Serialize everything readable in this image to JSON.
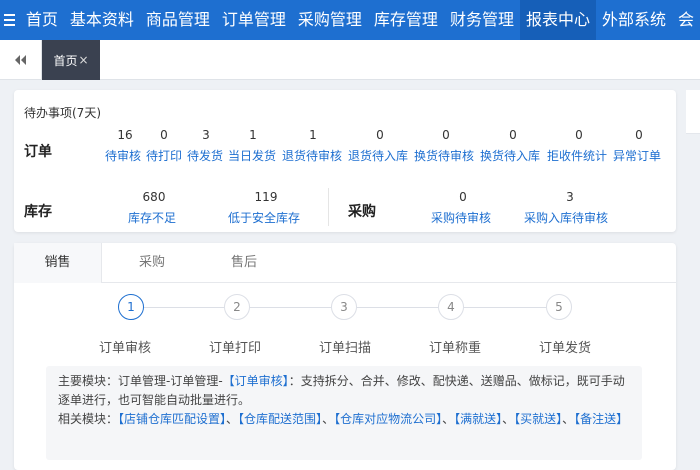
{
  "nav": {
    "items": [
      "首页",
      "基本资料",
      "商品管理",
      "订单管理",
      "采购管理",
      "库存管理",
      "财务管理",
      "报表中心",
      "外部系统",
      "会"
    ],
    "active_index": 7
  },
  "tabs": {
    "home_label": "首页",
    "close_glyph": "×"
  },
  "todo": {
    "title": "待办事项(7天)",
    "order": {
      "label": "订单",
      "items": [
        {
          "count": "16",
          "label": "待审核"
        },
        {
          "count": "0",
          "label": "待打印"
        },
        {
          "count": "3",
          "label": "待发货"
        },
        {
          "count": "1",
          "label": "当日发货"
        },
        {
          "count": "1",
          "label": "退货待审核"
        },
        {
          "count": "0",
          "label": "退货待入库"
        },
        {
          "count": "0",
          "label": "换货待审核"
        },
        {
          "count": "0",
          "label": "换货待入库"
        },
        {
          "count": "0",
          "label": "拒收件统计"
        },
        {
          "count": "0",
          "label": "异常订单"
        }
      ]
    },
    "stock": {
      "label": "库存",
      "items": [
        {
          "count": "680",
          "label": "库存不足"
        },
        {
          "count": "119",
          "label": "低于安全库存"
        }
      ]
    },
    "purchase": {
      "label": "采购",
      "items": [
        {
          "count": "0",
          "label": "采购待审核"
        },
        {
          "count": "3",
          "label": "采购入库待审核"
        }
      ]
    }
  },
  "flow": {
    "tabs": [
      "销售",
      "采购",
      "售后"
    ],
    "active_tab": 0,
    "steps": [
      {
        "num": "1",
        "label": "订单审核"
      },
      {
        "num": "2",
        "label": "订单打印"
      },
      {
        "num": "3",
        "label": "订单扫描"
      },
      {
        "num": "4",
        "label": "订单称重"
      },
      {
        "num": "5",
        "label": "订单发货"
      }
    ],
    "active_step": 0,
    "info": {
      "main_prefix": "主要模块：订单管理-订单管理-",
      "main_link": "【订单审核】",
      "main_desc": "：支持拆分、合并、修改、配快递、送赠品、做标记，既可手动逐单进行，也可智能自动批量进行。",
      "related_prefix": "相关模块：",
      "related_links": [
        "【店铺仓库匹配设置】",
        "【仓库配送范围】",
        "【仓库对应物流公司】",
        "【满就送】",
        "【买就送】",
        "【备注送】"
      ],
      "separator": "、"
    }
  },
  "colors": {
    "primary": "#1e6fd0",
    "nav_active": "#165fb8",
    "tab_active": "#3a4150"
  },
  "icons": {
    "menu": "hamburger-icon",
    "back": "double-chevron-left-icon"
  }
}
